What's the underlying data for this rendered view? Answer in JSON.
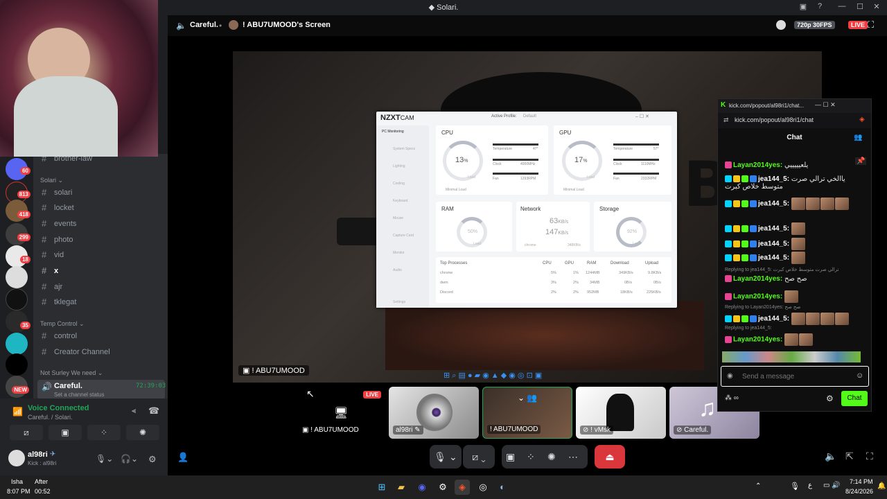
{
  "window": {
    "title": "Solari.",
    "icons": [
      "inbox-icon",
      "help-icon",
      "minimize-icon",
      "maximize-icon",
      "close-icon"
    ]
  },
  "stage": {
    "channel_name": "Careful.",
    "stream_title": "! ABU7UMOOD's Screen",
    "quality": "720p 30FPS",
    "live": "LIVE",
    "presenter_label": "! ABU7UMOOD"
  },
  "sidebar": {
    "server_badges": [
      "60",
      "813",
      "418",
      "299",
      "18",
      "35",
      "NEW"
    ],
    "partial_channel": "brother-law",
    "categories": [
      {
        "name": "Solari",
        "channels": [
          "solari",
          "locket",
          "events",
          "photo",
          "vid",
          "x",
          "ajr",
          "tklegat"
        ]
      },
      {
        "name": "Temp Control",
        "channels": [
          "control",
          "Creator Channel"
        ]
      },
      {
        "name": "Not Surley We need",
        "channels": []
      }
    ],
    "voice_channel": {
      "name": "Careful.",
      "status": "Set a channel status",
      "time": "72:39:03"
    }
  },
  "voice": {
    "status": "Voice Connected",
    "location": "Careful. / Solari."
  },
  "user": {
    "name": "al98ri",
    "status": "Kick : al98ri"
  },
  "nzxt": {
    "brand": "NZXT",
    "app": "CAM",
    "profile_label": "Active Profile:",
    "profile_value": "Default",
    "nav": [
      "PC Monitoring",
      "System Specs",
      "Lighting",
      "Cooling",
      "Keyboard",
      "Mouse",
      "Capture Card",
      "Monitor",
      "Audio",
      "Settings"
    ],
    "cpu": {
      "title": "CPU",
      "load": "13",
      "unit": "%",
      "sub": "Load",
      "temp_label": "Temperature",
      "temp": "47°",
      "clock_label": "Clock",
      "clock": "4000MHz",
      "fan_label": "Fan",
      "fan": "1293RPM",
      "note": "Minimal Load"
    },
    "gpu": {
      "title": "GPU",
      "load": "17",
      "unit": "%",
      "sub": "Load",
      "temp_label": "Temperature",
      "temp": "57°",
      "clock_label": "Clock",
      "clock": "1110MHz",
      "fan_label": "Fan",
      "fan": "2332RPM",
      "note": "Minimal Load"
    },
    "ram": {
      "title": "RAM",
      "load": "50%",
      "sub": "Load"
    },
    "network": {
      "title": "Network",
      "up": "63",
      "down": "147",
      "unit": "KB/s",
      "proc": "chrome",
      "proc_val": "348KB/s"
    },
    "storage": {
      "title": "Storage",
      "load": "92%",
      "sub": "Load"
    },
    "table": {
      "headers": [
        "Top Processes",
        "CPU",
        "GPU",
        "RAM",
        "Download",
        "Upload"
      ],
      "rows": [
        [
          "chrome",
          "5%",
          "1%",
          "1244MB",
          "349KB/s",
          "9.8KB/s"
        ],
        [
          "dwm",
          "3%",
          "2%",
          "34MB",
          "0B/s",
          "0B/s"
        ],
        [
          "Discord",
          "2%",
          "2%",
          "952MB",
          "18KB/s",
          "225KB/s"
        ]
      ]
    }
  },
  "participants": [
    {
      "name": "! ABU7UMOOD",
      "live": "LIVE"
    },
    {
      "name": "al98ri"
    },
    {
      "name": "! ABU7UMOOD"
    },
    {
      "name": "! vMsk"
    },
    {
      "name": "Careful."
    }
  ],
  "kick": {
    "url_title": "kick.com/popout/al98ri1/chat...",
    "url": "kick.com/popout/al98ri1/chat",
    "header": "Chat",
    "messages": [
      {
        "user": "Layan2014yes:",
        "text": "يلعيييييي"
      },
      {
        "user": "jea144_5:",
        "text": "ياالخي ترالي صرت متوسط خلاص كبرت"
      },
      {
        "user": "jea144_5:",
        "text": ""
      },
      {
        "user": "jea144_5:",
        "text": ""
      },
      {
        "user": "jea144_5:",
        "text": ""
      },
      {
        "user": "jea144_5:",
        "text": ""
      },
      {
        "reply": "Replying to jea144_5: ترالي صرت متوسط خلاص كبرت",
        "user": "Layan2014yes:",
        "text": "صح صح"
      },
      {
        "user": "Layan2014yes:",
        "text": ""
      },
      {
        "reply": "Replying to Layan2014yes: صح صح",
        "user": "jea144_5:",
        "text": ""
      },
      {
        "reply": "Replying to jea144_5:",
        "user": "Layan2014yes:",
        "text": ""
      }
    ],
    "input_placeholder": "Send a message",
    "send": "Chat"
  },
  "clock": {
    "time": "7:14 PM",
    "date": "8/24/2026"
  },
  "prayer": {
    "name": "Isha",
    "time": "8:07 PM",
    "after_label": "After",
    "after_time": "00:52"
  },
  "lang": "ع"
}
